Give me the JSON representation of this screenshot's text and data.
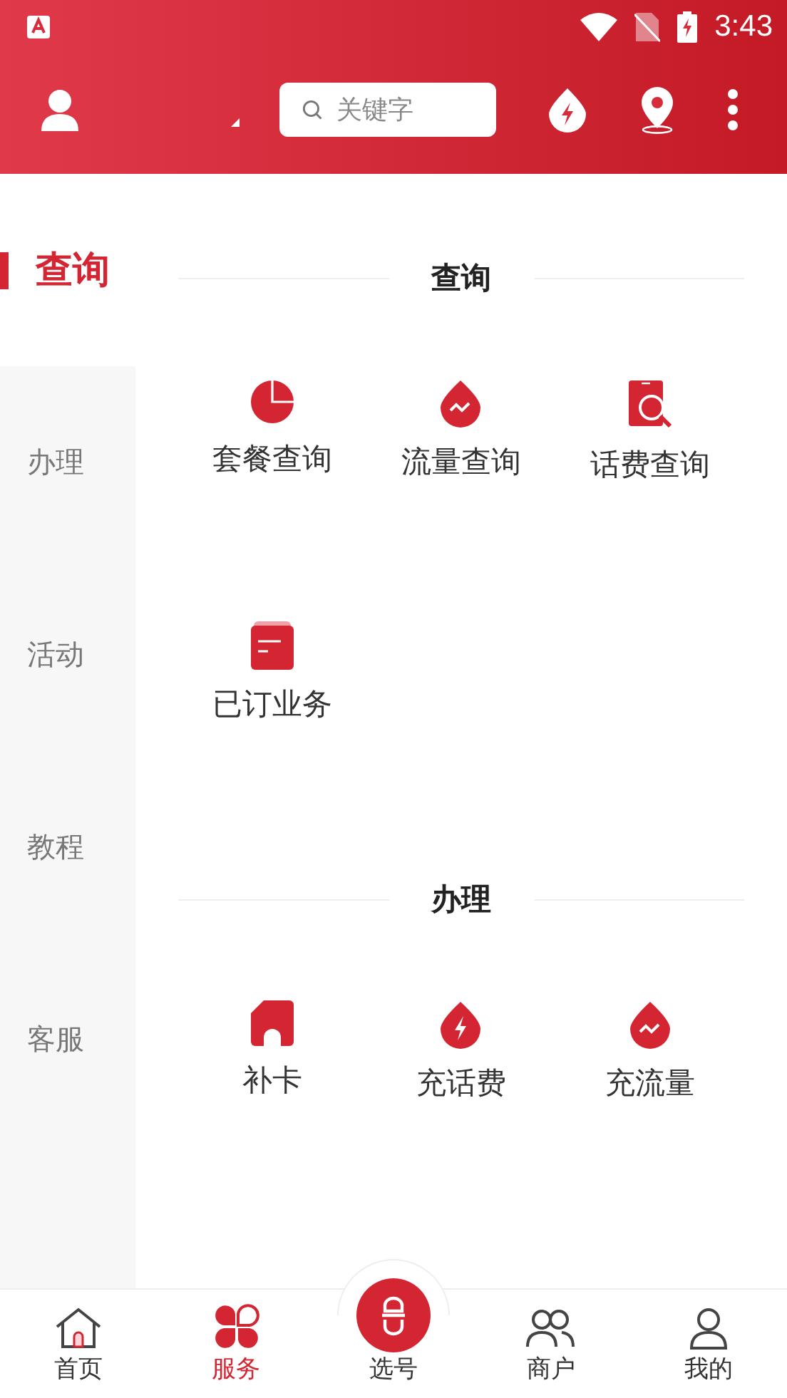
{
  "status_bar": {
    "time": "3:43"
  },
  "header": {
    "search": {
      "placeholder": "关键字"
    }
  },
  "sidebar": [
    {
      "label": "查询",
      "selected": true
    },
    {
      "label": "办理",
      "selected": false
    },
    {
      "label": "活动",
      "selected": false
    },
    {
      "label": "教程",
      "selected": false
    },
    {
      "label": "客服",
      "selected": false
    }
  ],
  "sections": [
    {
      "title": "查询",
      "items": [
        {
          "label": "套餐查询"
        },
        {
          "label": "流量查询"
        },
        {
          "label": "话费查询"
        },
        {
          "label": "已订业务"
        }
      ]
    },
    {
      "title": "办理",
      "items": [
        {
          "label": "补卡"
        },
        {
          "label": "充话费"
        },
        {
          "label": "充流量"
        }
      ]
    }
  ],
  "bottom_nav": [
    {
      "label": "首页",
      "selected": false
    },
    {
      "label": "服务",
      "selected": true
    },
    {
      "label": "选号",
      "selected": false
    },
    {
      "label": "商户",
      "selected": false
    },
    {
      "label": "我的",
      "selected": false
    }
  ]
}
